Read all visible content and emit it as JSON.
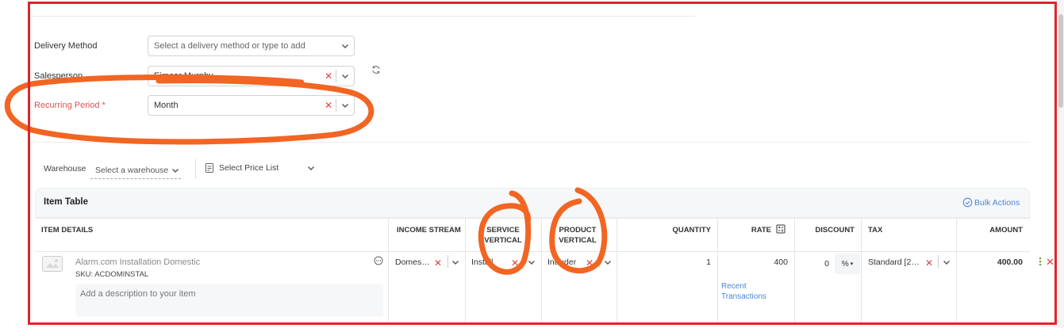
{
  "form": {
    "delivery_method": {
      "label": "Delivery Method",
      "placeholder": "Select a delivery method or type to add"
    },
    "salesperson": {
      "label": "Salesperson",
      "value": "Eimear Murphy"
    },
    "recurring_period": {
      "label": "Recurring Period *",
      "value": "Month"
    }
  },
  "toolbar": {
    "warehouse_label": "Warehouse",
    "warehouse_placeholder": "Select a warehouse",
    "price_list_label": "Select Price List"
  },
  "item_table": {
    "title": "Item Table",
    "bulk_actions": "Bulk Actions",
    "columns": {
      "item_details": "ITEM DETAILS",
      "income_stream": "INCOME STREAM",
      "service_vertical_1": "SERVICE",
      "service_vertical_2": "VERTICAL",
      "product_vertical_1": "PRODUCT",
      "product_vertical_2": "VERTICAL",
      "quantity": "QUANTITY",
      "rate": "RATE",
      "discount": "DISCOUNT",
      "tax": "TAX",
      "amount": "AMOUNT"
    },
    "row": {
      "item_name": "Alarm.com Installation Domestic",
      "sku": "SKU: ACDOMINSTAL",
      "description_placeholder": "Add a description to your item",
      "income_stream": "Domes…",
      "service_vertical": "Install",
      "product_vertical": "Intruder",
      "quantity": "1",
      "rate": "400",
      "recent_transactions_1": "Recent",
      "recent_transactions_2": "Transactions",
      "discount": "0",
      "discount_unit": "%",
      "tax": "Standard [2…",
      "amount": "400.00"
    }
  },
  "colors": {
    "annotation": "#f26522",
    "frame": "#e0242a",
    "link": "#4a86d8",
    "required": "#d9534f"
  }
}
